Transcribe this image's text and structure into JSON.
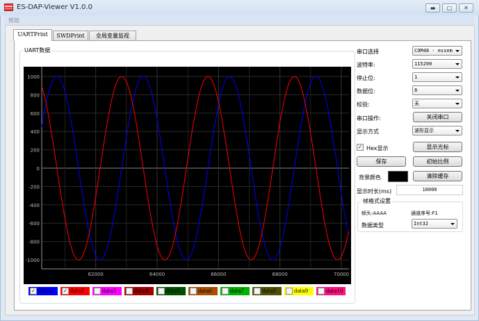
{
  "window": {
    "title": "ES-DAP-Viewer V1.0.0",
    "minimize_icon": "minimize-icon",
    "maximize_icon": "maximize-icon",
    "close_icon": "close-icon"
  },
  "menu": {
    "help": "帮助"
  },
  "tabs": [
    {
      "label": "UARTPrint",
      "active": true
    },
    {
      "label": "SWDPrint"
    },
    {
      "label": "全局变量监视"
    }
  ],
  "uart_group": {
    "title": "UART数据"
  },
  "legend": [
    {
      "label": "data1",
      "color": "#0000ff",
      "checked": true
    },
    {
      "label": "data2",
      "color": "#ff0000",
      "checked": true
    },
    {
      "label": "data3",
      "color": "#ff00ff",
      "checked": false
    },
    {
      "label": "data4",
      "color": "#a00000",
      "checked": false
    },
    {
      "label": "data5",
      "color": "#005000",
      "checked": false
    },
    {
      "label": "data6",
      "color": "#a85000",
      "checked": false
    },
    {
      "label": "data7",
      "color": "#00b000",
      "checked": false
    },
    {
      "label": "data8",
      "color": "#505000",
      "checked": false
    },
    {
      "label": "data9",
      "color": "#ffff00",
      "checked": false
    },
    {
      "label": "data10",
      "color": "#ff1080",
      "checked": false
    }
  ],
  "settings": {
    "port_label": "串口选择",
    "port_value": "COM48 - essem",
    "baud_label": "波特率:",
    "baud_value": "115200",
    "stop_label": "停止位:",
    "stop_value": "1",
    "databits_label": "数据位:",
    "databits_value": "8",
    "parity_label": "校验:",
    "parity_value": "无",
    "op_label": "串口操作:",
    "op_button": "关闭串口",
    "mode_label": "显示方式",
    "mode_value": "波形显示",
    "hex_label": "Hex显示",
    "hex_checked": true,
    "cursor_button": "显示光标",
    "save_button": "保存",
    "reset_scale_button": "初始比例",
    "bg_label": "背景颜色",
    "bg_color": "#000000",
    "clear_button": "清除缓存",
    "duration_label": "显示时长(ms)",
    "duration_value": "10000"
  },
  "frame": {
    "title": "帧格式设置",
    "header": "帧头:AAAA",
    "channel": "通道序号:F1",
    "type_label": "数据类型",
    "type_value": "Int32"
  },
  "chart_data": {
    "type": "line",
    "xlim": [
      60240,
      70250
    ],
    "ylim": [
      -1100,
      1100
    ],
    "x_ticks": [
      62000,
      64000,
      66000,
      68000,
      70000
    ],
    "y_ticks": [
      1000,
      800,
      600,
      400,
      200,
      0,
      -200,
      -400,
      -600,
      -800,
      -1000
    ],
    "grid": true,
    "background": "#000000",
    "series": [
      {
        "name": "data1",
        "color": "#0000ff",
        "shape": "sine",
        "amplitude": 1000,
        "period": 2813,
        "peak_x": 63547
      },
      {
        "name": "data2",
        "color": "#ff0000",
        "shape": "sine",
        "amplitude": 1000,
        "period": 2813,
        "peak_x": 62845
      }
    ]
  }
}
